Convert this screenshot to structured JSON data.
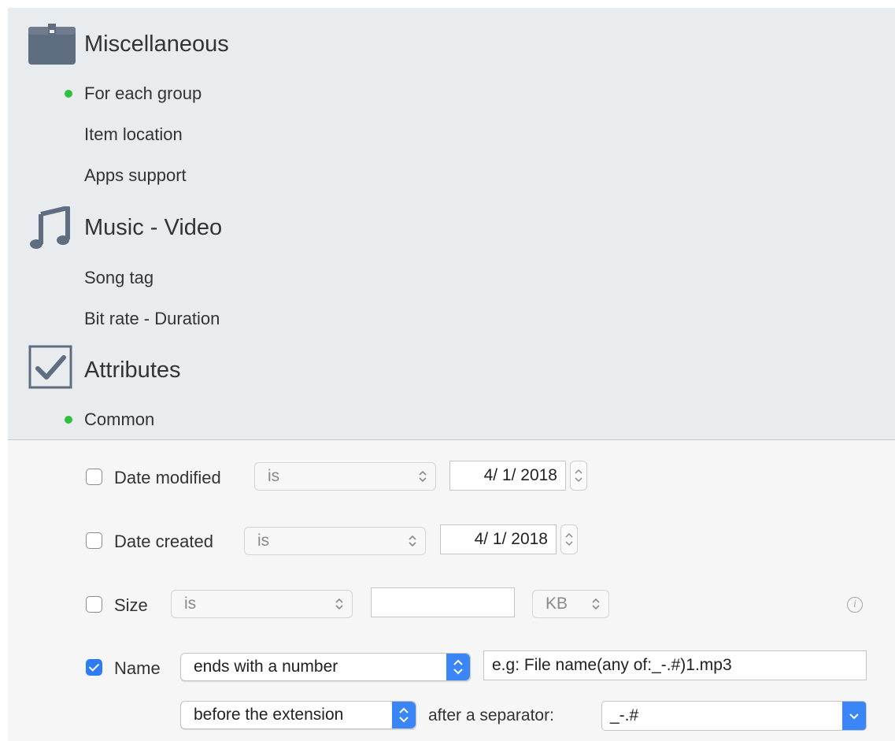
{
  "categories": [
    {
      "title": "Miscellaneous",
      "icon": "box-icon",
      "items": [
        {
          "label": "For each group",
          "active": true
        },
        {
          "label": "Item location",
          "active": false
        },
        {
          "label": "Apps support",
          "active": false
        }
      ]
    },
    {
      "title": "Music - Video",
      "icon": "music-note-icon",
      "items": [
        {
          "label": "Song tag",
          "active": false
        },
        {
          "label": "Bit rate - Duration",
          "active": false
        }
      ]
    },
    {
      "title": "Attributes",
      "icon": "checkmark-box-icon",
      "items": [
        {
          "label": "Common",
          "active": true
        }
      ]
    }
  ],
  "filters": {
    "date_modified": {
      "label": "Date modified",
      "checked": false,
      "operator": "is",
      "value": "4/  1/ 2018"
    },
    "date_created": {
      "label": "Date created",
      "checked": false,
      "operator": "is",
      "value": "4/  1/ 2018"
    },
    "size": {
      "label": "Size",
      "checked": false,
      "operator": "is",
      "value": "",
      "unit": "KB"
    },
    "name": {
      "label": "Name",
      "checked": true,
      "operator": "ends with a number",
      "value": "e.g: File name(any of:_-.#)1.mp3",
      "position": "before the extension",
      "separator_label": "after a separator:",
      "separator_value": "_-.#"
    }
  },
  "colors": {
    "active_dot": "#2fc03e",
    "accent_blue": "#2d7cf6",
    "top_panel_bg": "#e9ecee"
  }
}
